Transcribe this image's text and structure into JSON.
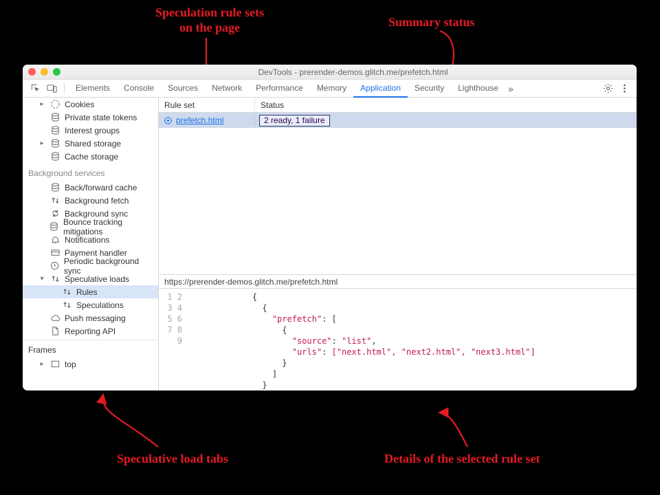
{
  "annotations": {
    "topLeft": "Speculation rule sets\non the page",
    "topRight": "Summary status",
    "bottomLeft": "Speculative load tabs",
    "bottomRight": "Details of the selected rule set"
  },
  "window": {
    "title": "DevTools - prerender-demos.glitch.me/prefetch.html"
  },
  "tabs": {
    "items": [
      "Elements",
      "Console",
      "Sources",
      "Network",
      "Performance",
      "Memory",
      "Application",
      "Security",
      "Lighthouse"
    ],
    "active": "Application",
    "overflow": "»"
  },
  "sidebar": {
    "groupA": [
      {
        "label": "Cookies",
        "icon": "cookie",
        "chev": "▸"
      },
      {
        "label": "Private state tokens",
        "icon": "db"
      },
      {
        "label": "Interest groups",
        "icon": "db"
      },
      {
        "label": "Shared storage",
        "icon": "db",
        "chev": "▸"
      },
      {
        "label": "Cache storage",
        "icon": "db"
      }
    ],
    "bgHeading": "Background services",
    "groupB": [
      {
        "label": "Back/forward cache",
        "icon": "db"
      },
      {
        "label": "Background fetch",
        "icon": "updown"
      },
      {
        "label": "Background sync",
        "icon": "sync"
      },
      {
        "label": "Bounce tracking mitigations",
        "icon": "db"
      },
      {
        "label": "Notifications",
        "icon": "bell"
      },
      {
        "label": "Payment handler",
        "icon": "card"
      },
      {
        "label": "Periodic background sync",
        "icon": "clock"
      },
      {
        "label": "Speculative loads",
        "icon": "updown",
        "chev": "▾",
        "expanded": true
      },
      {
        "label": "Rules",
        "icon": "updown",
        "indent": 2,
        "selected": true
      },
      {
        "label": "Speculations",
        "icon": "updown",
        "indent": 2
      },
      {
        "label": "Push messaging",
        "icon": "cloud"
      },
      {
        "label": "Reporting API",
        "icon": "doc"
      }
    ],
    "framesHeading": "Frames",
    "frames": [
      {
        "label": "top",
        "icon": "frame",
        "chev": "▸"
      }
    ]
  },
  "ruleTable": {
    "headers": {
      "ruleSet": "Rule set",
      "status": "Status"
    },
    "rows": [
      {
        "ruleSet": "prefetch.html",
        "status": "2 ready, 1 failure"
      }
    ]
  },
  "detail": {
    "path": "https://prerender-demos.glitch.me/prefetch.html",
    "lineCount": 9,
    "json": {
      "key1": "\"prefetch\"",
      "key2": "\"source\"",
      "val2": "\"list\"",
      "key3": "\"urls\"",
      "arr": "[\"next.html\", \"next2.html\", \"next3.html\"]"
    }
  }
}
